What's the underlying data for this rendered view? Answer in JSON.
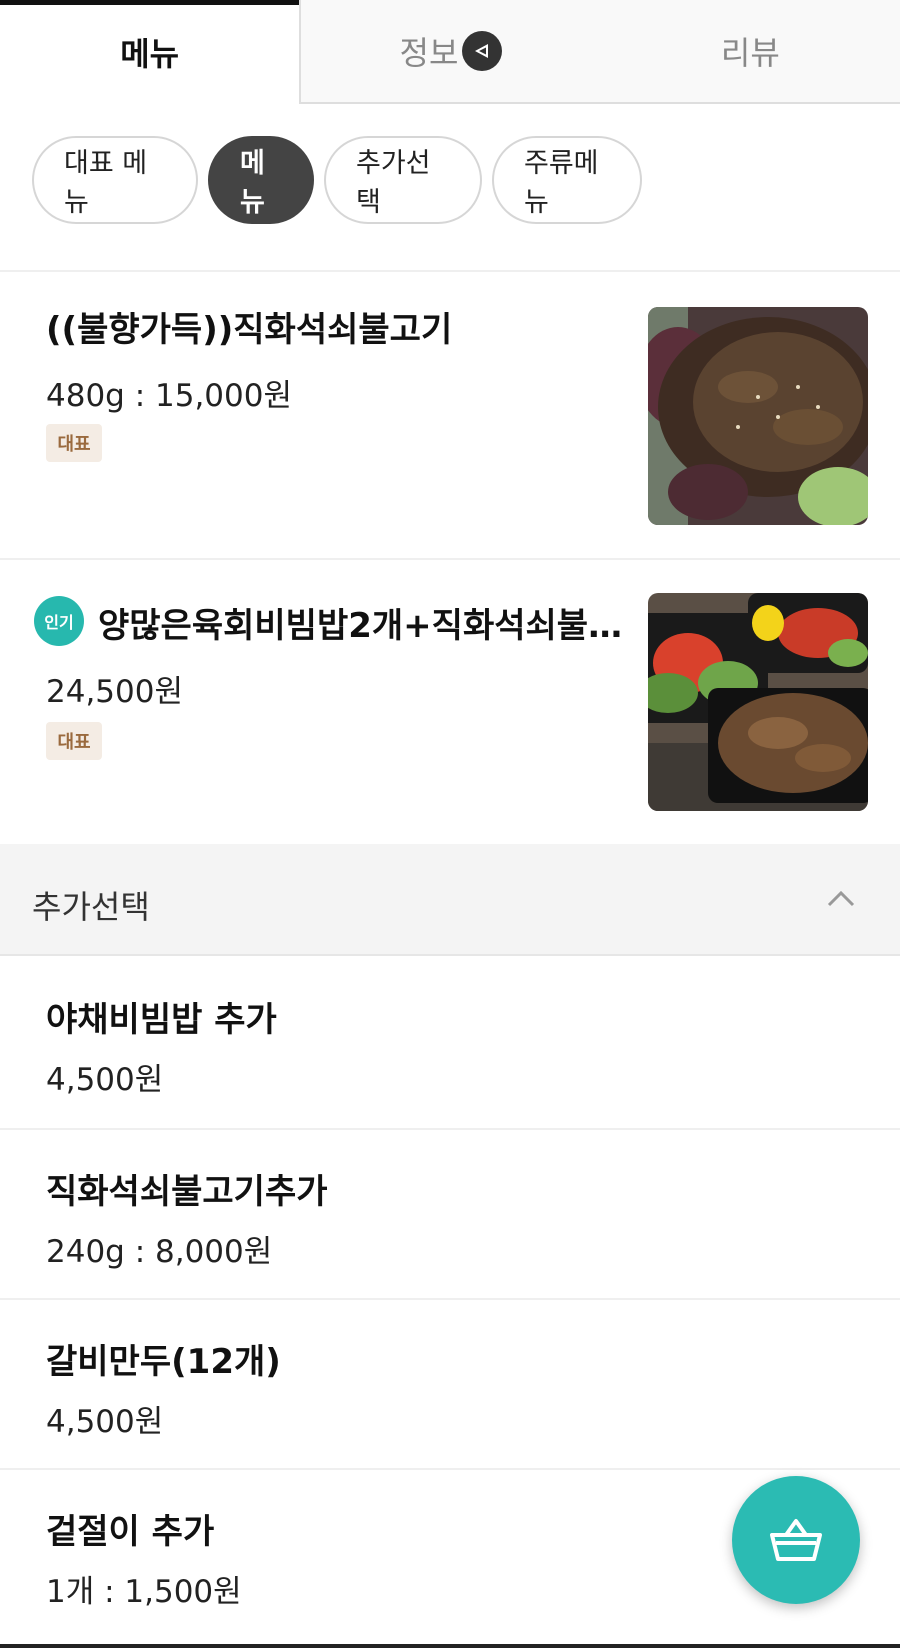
{
  "tabs": [
    {
      "label": "메뉴",
      "active": true
    },
    {
      "label": "정보",
      "active": false,
      "icon": "megaphone-icon"
    },
    {
      "label": "리뷰",
      "active": false
    }
  ],
  "chips": [
    {
      "label": "대표 메뉴",
      "active": false
    },
    {
      "label": "메뉴",
      "active": true
    },
    {
      "label": "추가선택",
      "active": false
    },
    {
      "label": "주류메뉴",
      "active": false
    }
  ],
  "featured": [
    {
      "title": "((불향가득))직화석쇠불고기",
      "price": "480g : 15,000원",
      "badge": "대표",
      "popular": ""
    },
    {
      "title": "양많은육회비빔밥2개+직화석쇠불…",
      "price": "24,500원",
      "badge": "대표",
      "popular": "인기"
    }
  ],
  "section": {
    "title": "추가선택",
    "expanded": true
  },
  "extras": [
    {
      "title": "야채비빔밥 추가",
      "price": "4,500원"
    },
    {
      "title": "직화석쇠불고기추가",
      "price": "240g : 8,000원"
    },
    {
      "title": "갈비만두(12개)",
      "price": "4,500원"
    },
    {
      "title": "겉절이 추가",
      "price": "1개 : 1,500원"
    }
  ],
  "colors": {
    "accent": "#2bbbb3",
    "badge_bg": "#f4ece4",
    "badge_text": "#9a6a3e"
  },
  "cart": {
    "icon": "basket-icon"
  }
}
